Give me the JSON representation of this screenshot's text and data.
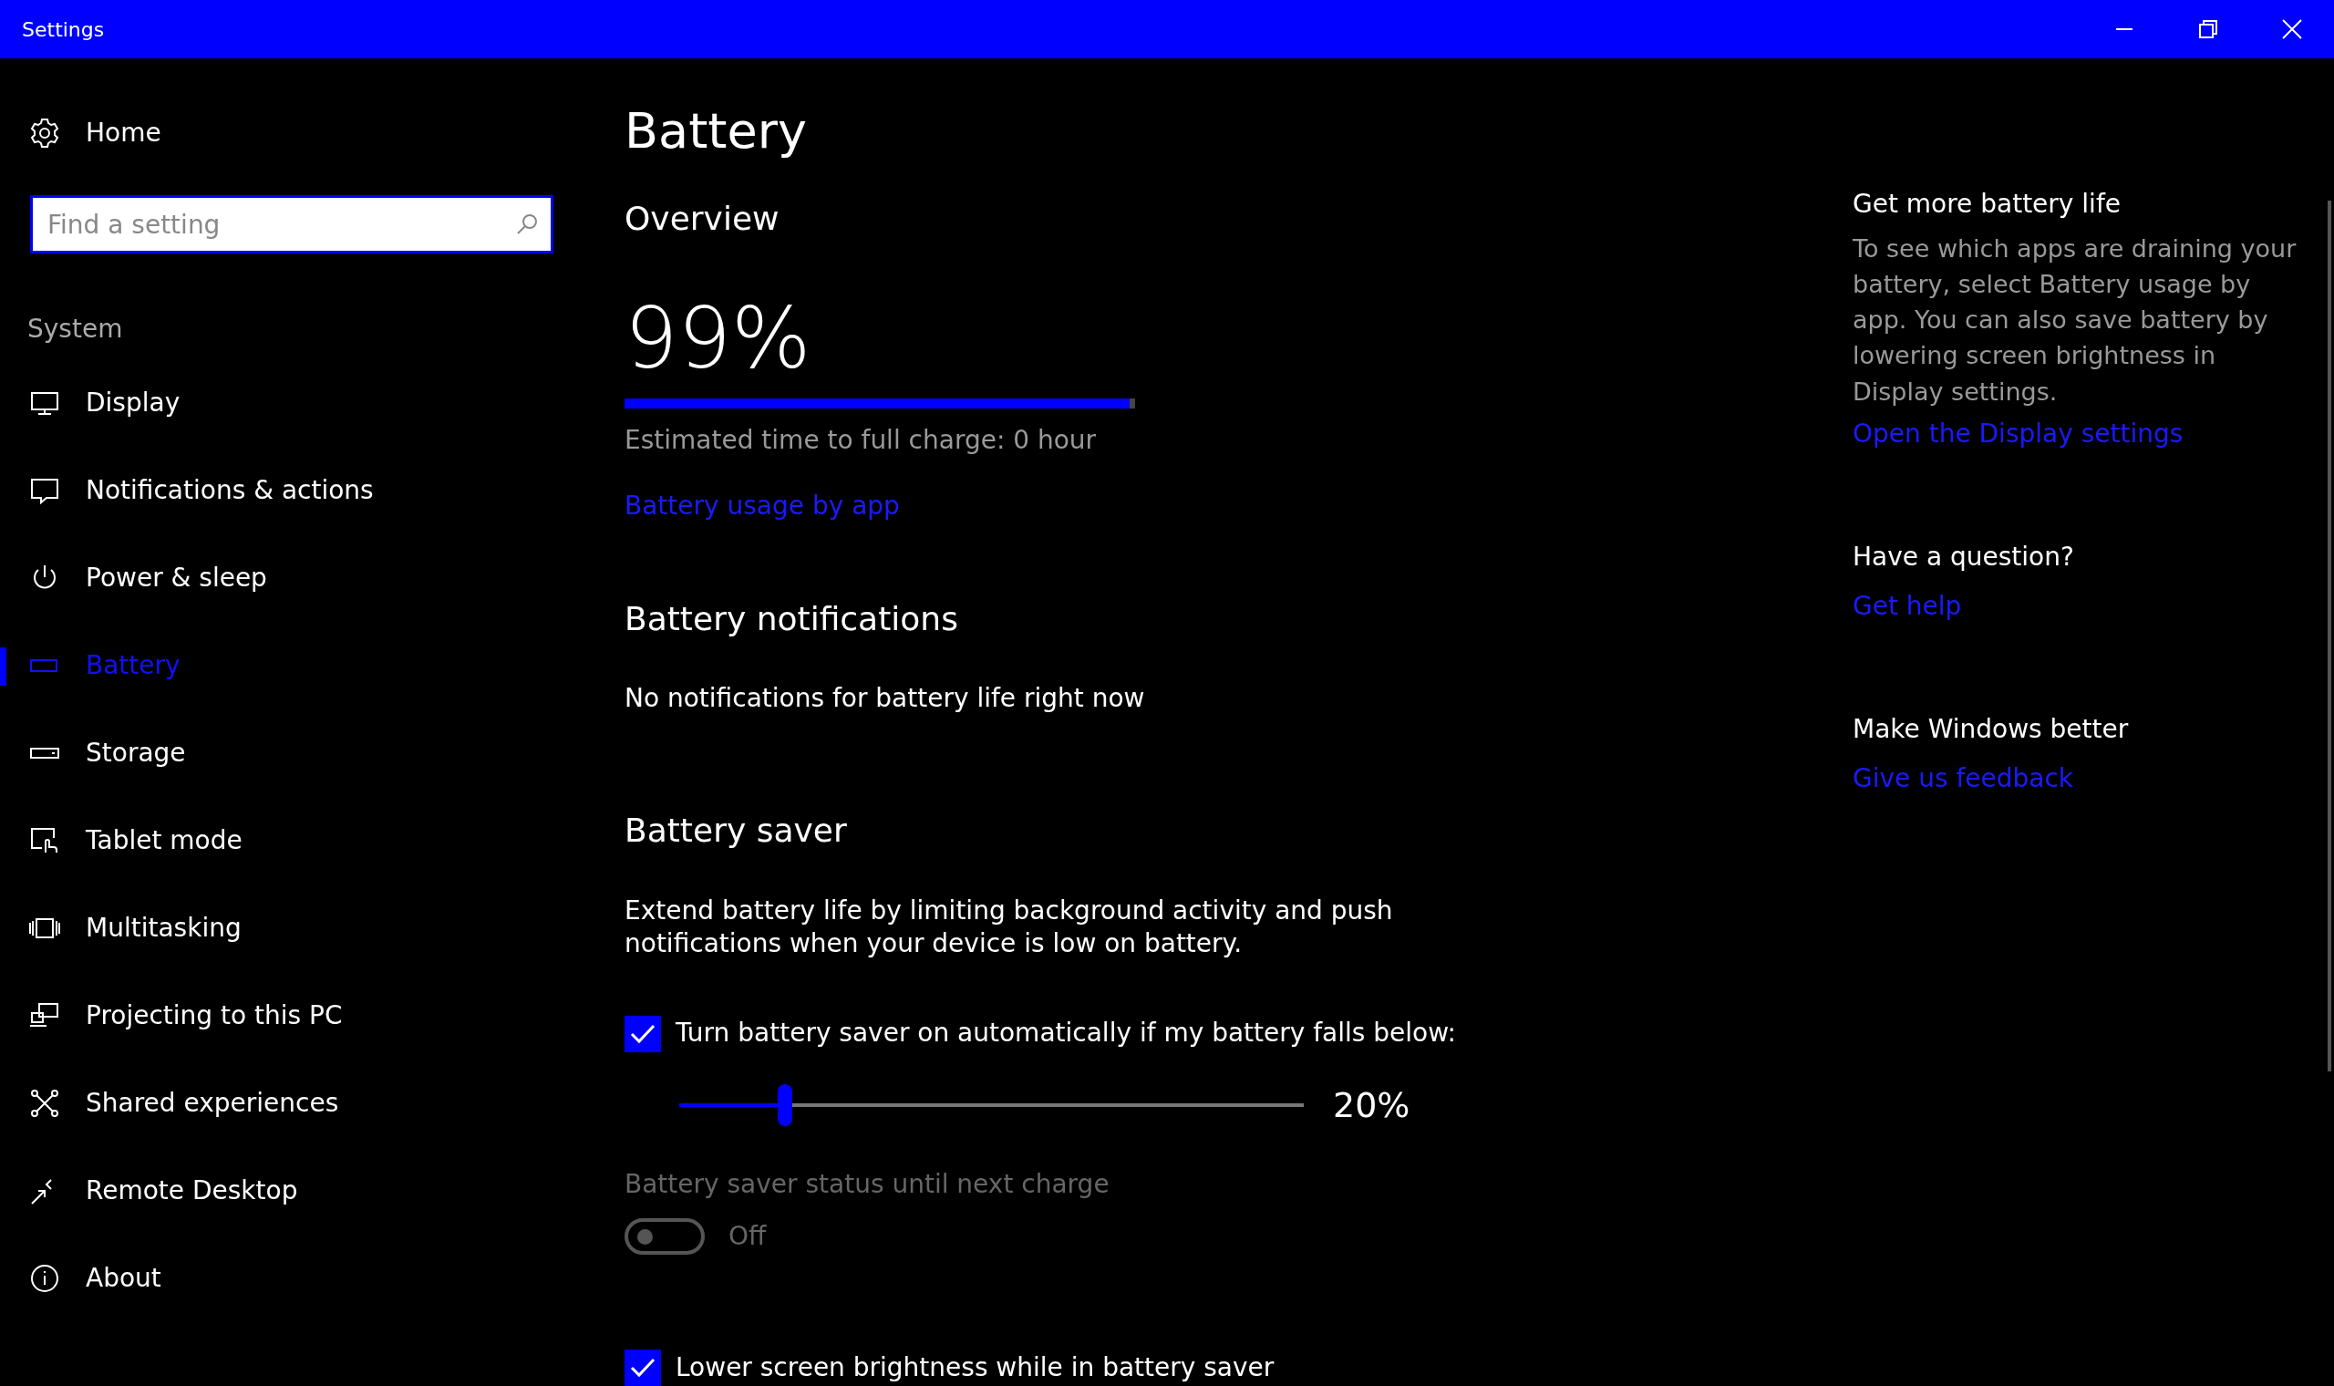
{
  "window": {
    "title": "Settings"
  },
  "sidebar": {
    "home": "Home",
    "search": {
      "placeholder": "Find a setting"
    },
    "section": "System",
    "items": [
      {
        "label": "Display",
        "selected": false
      },
      {
        "label": "Notifications & actions",
        "selected": false
      },
      {
        "label": "Power & sleep",
        "selected": false
      },
      {
        "label": "Battery",
        "selected": true
      },
      {
        "label": "Storage",
        "selected": false
      },
      {
        "label": "Tablet mode",
        "selected": false
      },
      {
        "label": "Multitasking",
        "selected": false
      },
      {
        "label": "Projecting to this PC",
        "selected": false
      },
      {
        "label": "Shared experiences",
        "selected": false
      },
      {
        "label": "Remote Desktop",
        "selected": false
      },
      {
        "label": "About",
        "selected": false
      }
    ]
  },
  "main": {
    "title": "Battery",
    "overview": {
      "heading": "Overview",
      "percent": "99%",
      "level": 0.99,
      "estimate": "Estimated time to full charge: 0 hour",
      "link": "Battery usage by app"
    },
    "notifications": {
      "heading": "Battery notifications",
      "text": "No notifications for battery life right now"
    },
    "saver": {
      "heading": "Battery saver",
      "description": "Extend battery life by limiting background activity and push notifications when your device is low on battery.",
      "auto": {
        "label": "Turn battery saver on automatically if my battery falls below:",
        "checked": true
      },
      "threshold": {
        "level": 0.17,
        "reading": "20%"
      },
      "status": {
        "label": "Battery saver status until next charge",
        "disabled": true,
        "on": false,
        "state_text": "Off"
      },
      "brightness": {
        "label": "Lower screen brightness while in battery saver",
        "checked": true
      }
    }
  },
  "help_panel": [
    {
      "heading": "Get more battery life",
      "text": "To see which apps are draining your battery, select Battery usage by app. You can also save battery by lowering screen brightness in Display settings.",
      "link": "Open the Display settings"
    },
    {
      "heading": "Have a question?",
      "link": "Get help"
    },
    {
      "heading": "Make Windows better",
      "link": "Give us feedback"
    }
  ]
}
